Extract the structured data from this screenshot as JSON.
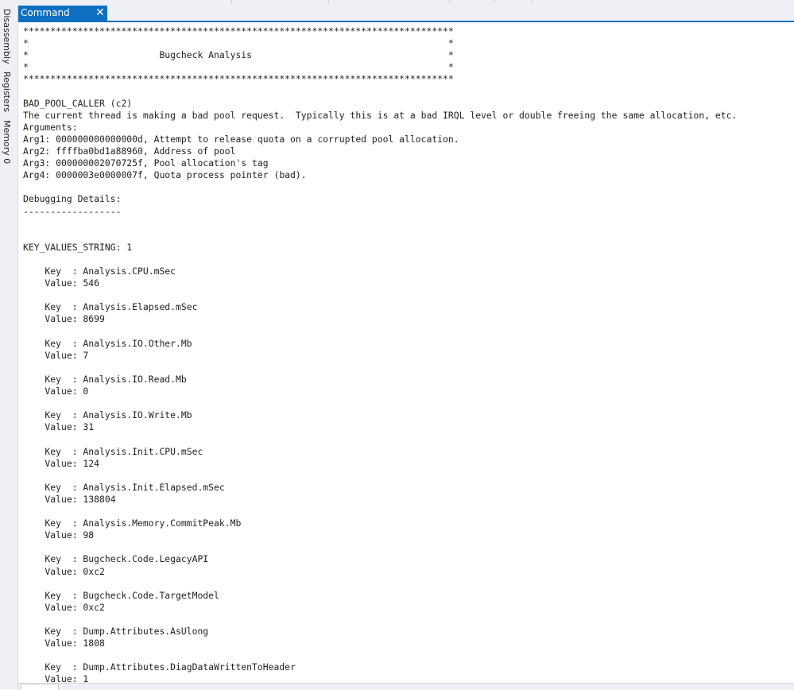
{
  "sidebar": {
    "tabs": [
      "Disassembly",
      "Registers",
      "Memory 0"
    ]
  },
  "tab": {
    "title": "Command",
    "close_glyph": "✕"
  },
  "output": {
    "lines": [
      "*******************************************************************************",
      "*                                                                             *",
      "*                        Bugcheck Analysis                                    *",
      "*                                                                             *",
      "*******************************************************************************",
      "",
      "BAD_POOL_CALLER (c2)",
      "The current thread is making a bad pool request.  Typically this is at a bad IRQL level or double freeing the same allocation, etc.",
      "Arguments:",
      "Arg1: 000000000000000d, Attempt to release quota on a corrupted pool allocation.",
      "Arg2: ffffba0bd1a88960, Address of pool",
      "Arg3: 000000002070725f, Pool allocation's tag",
      "Arg4: 0000003e0000007f, Quota process pointer (bad).",
      "",
      "Debugging Details:",
      "------------------",
      "",
      "",
      "KEY_VALUES_STRING: 1",
      "",
      "    Key  : Analysis.CPU.mSec",
      "    Value: 546",
      "",
      "    Key  : Analysis.Elapsed.mSec",
      "    Value: 8699",
      "",
      "    Key  : Analysis.IO.Other.Mb",
      "    Value: 7",
      "",
      "    Key  : Analysis.IO.Read.Mb",
      "    Value: 0",
      "",
      "    Key  : Analysis.IO.Write.Mb",
      "    Value: 31",
      "",
      "    Key  : Analysis.Init.CPU.mSec",
      "    Value: 124",
      "",
      "    Key  : Analysis.Init.Elapsed.mSec",
      "    Value: 138804",
      "",
      "    Key  : Analysis.Memory.CommitPeak.Mb",
      "    Value: 98",
      "",
      "    Key  : Bugcheck.Code.LegacyAPI",
      "    Value: 0xc2",
      "",
      "    Key  : Bugcheck.Code.TargetModel",
      "    Value: 0xc2",
      "",
      "    Key  : Dump.Attributes.AsUlong",
      "    Value: 1808",
      "",
      "    Key  : Dump.Attributes.DiagDataWrittenToHeader",
      "    Value: 1"
    ]
  }
}
